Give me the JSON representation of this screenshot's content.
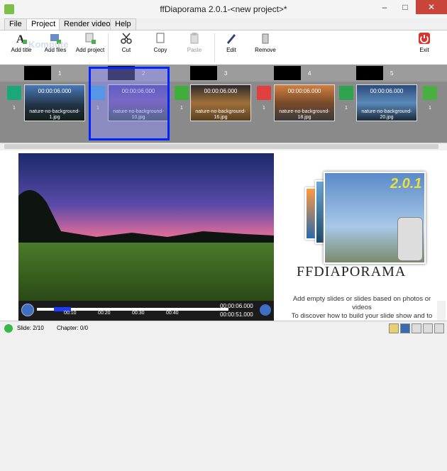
{
  "window": {
    "title": "ffDiaporama 2.0.1-<new project>*",
    "minimize": "–",
    "maximize": "□",
    "close": "✕"
  },
  "tabs": [
    {
      "label": "File"
    },
    {
      "label": "Project"
    },
    {
      "label": "Render video"
    },
    {
      "label": "Help"
    }
  ],
  "ribbon": {
    "add_title": "Add title",
    "add_files": "Add files",
    "add_project": "Add project",
    "cut": "Cut",
    "copy": "Copy",
    "paste": "Paste",
    "edit": "Edit",
    "remove": "Remove",
    "exit": "Exit",
    "watermark": "Kompute"
  },
  "timeline": {
    "slides": [
      {
        "num": "1",
        "duration": "00:00:06.000",
        "file": "nature-no-background-1.jpg",
        "trans": "1"
      },
      {
        "num": "2",
        "duration": "00:00:06.000",
        "file": "nature-no-background-10.jpg",
        "trans": "1"
      },
      {
        "num": "3",
        "duration": "00:00:06.000",
        "file": "nature-no-background-16.jpg",
        "trans": "1"
      },
      {
        "num": "4",
        "duration": "00:00:06.000",
        "file": "nature-no-background-18.jpg",
        "trans": "1"
      },
      {
        "num": "5",
        "duration": "00:00:06.000",
        "file": "nature-no-background-20.jpg",
        "trans": "1"
      }
    ],
    "first_trans": "1",
    "last_trans": "1"
  },
  "player": {
    "ticks": [
      "00:10",
      "00:20",
      "00:30",
      "00:40"
    ],
    "current_time": "00:00:06.000",
    "total_time": "00:00:51.000"
  },
  "logo": {
    "version": "2.0.1",
    "name": "FFDIAPORAMA"
  },
  "hint": "Add empty slides or slides based on photos or videos\nTo discover how to build your slide show and to",
  "status": {
    "slide": "Slide: 2/10",
    "chapter": "Chapter: 0/0"
  }
}
